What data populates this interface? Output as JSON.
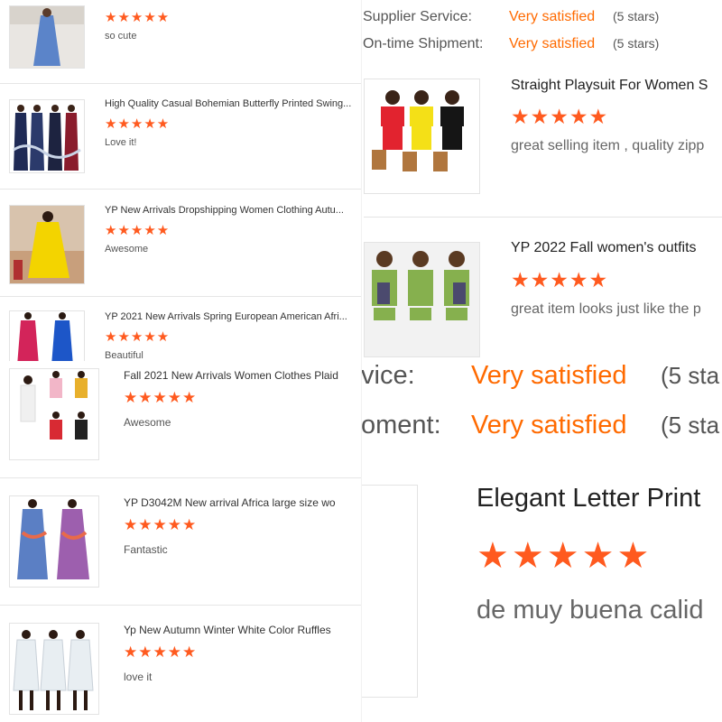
{
  "star_glyphs": "★★★★★",
  "colors": {
    "star": "#ff5a1f",
    "satisfied": "#ff6a00",
    "divider": "#e3e3e3"
  },
  "panel_a": {
    "reviews": [
      {
        "title": "",
        "comment": "so cute",
        "thumb_icon": "blue-dress-photo"
      },
      {
        "title": "High Quality Casual Bohemian Butterfly Printed Swing...",
        "comment": "Love it!",
        "thumb_icon": "bohemian-dresses-photo"
      },
      {
        "title": "YP New Arrivals Dropshipping Women Clothing Autu...",
        "comment": "Awesome",
        "thumb_icon": "yellow-dress-photo"
      },
      {
        "title": "YP 2021 New Arrivals Spring European American Afri...",
        "comment": "Beautiful",
        "thumb_icon": "red-blue-dress-photo"
      }
    ]
  },
  "panel_b": {
    "ratings": [
      {
        "label": "Supplier Service:",
        "value": "Very satisfied",
        "count": "(5 stars)"
      },
      {
        "label": "On-time Shipment:",
        "value": "Very satisfied",
        "count": "(5 stars)"
      }
    ],
    "reviews": [
      {
        "title": "Straight Playsuit For Women S",
        "comment": "great selling item , quality zipp",
        "thumb_icon": "playsuit-photo"
      },
      {
        "title": "YP 2022 Fall women's outfits",
        "comment": "great item looks just like the p",
        "thumb_icon": "green-outfit-photo"
      }
    ]
  },
  "panel_c": {
    "reviews": [
      {
        "title": "Fall 2021 New Arrivals Women Clothes Plaid",
        "comment": "Awesome",
        "thumb_icon": "plaid-clothes-photo"
      },
      {
        "title": "YP D3042M New arrival Africa large size wo",
        "comment": "Fantastic",
        "thumb_icon": "africa-dress-photo"
      },
      {
        "title": "Yp New Autumn Winter White Color Ruffles",
        "comment": "love it",
        "thumb_icon": "white-ruffle-dress-photo"
      }
    ]
  },
  "panel_d": {
    "ratings": [
      {
        "label": "vice:",
        "value": "Very satisfied",
        "count": "(5 sta"
      },
      {
        "label": "oment:",
        "value": "Very satisfied",
        "count": "(5 sta"
      }
    ],
    "review": {
      "title": "Elegant Letter Print",
      "comment": "de muy buena calid"
    }
  }
}
